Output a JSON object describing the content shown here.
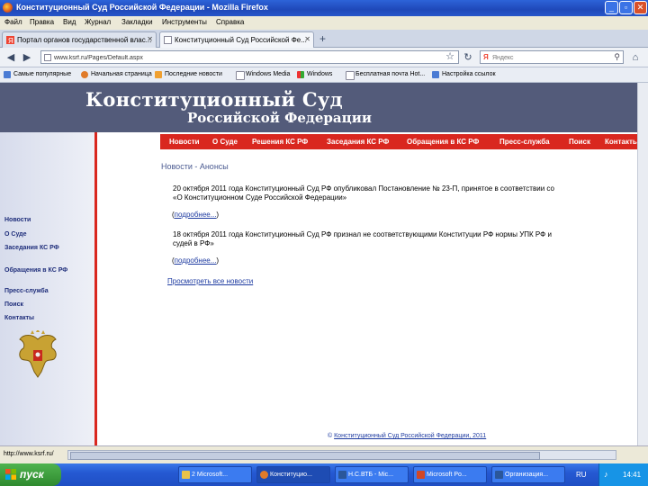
{
  "window": {
    "title": "Конституционный Суд Российской Федерации - Mozilla Firefox",
    "buttons": [
      "_",
      "▫",
      "✕"
    ]
  },
  "menu": [
    "Файл",
    "Правка",
    "Вид",
    "Журнал",
    "Закладки",
    "Инструменты",
    "Справка"
  ],
  "tabs": [
    {
      "label": "Портал органов государственной влас...",
      "active": false
    },
    {
      "label": "Конституционный Суд Российской Фе...",
      "active": true
    }
  ],
  "new_tab_label": "+",
  "nav": {
    "url": "www.ksrf.ru/Pages/Default.aspx",
    "search_placeholder": "Яндекс"
  },
  "bookmarks": [
    "Самые популярные",
    "Начальная страница",
    "Последние новости",
    "Windows Media",
    "Windows",
    "Бесплатная почта Hot...",
    "Настройка ссылок"
  ],
  "site": {
    "title_line1": "Конституционный Суд",
    "title_line2": "Российской Федерации",
    "top_nav": [
      "Новости",
      "О Суде",
      "Решения КС РФ",
      "Заседания КС РФ",
      "Обращения в КС РФ",
      "Пресс-служба",
      "Поиск",
      "Контакты"
    ],
    "sidebar": [
      "Новости",
      "О Суде",
      "Заседания КС РФ",
      "Обращения в КС РФ",
      "Пресс-служба",
      "Поиск",
      "Контакты"
    ],
    "section_title": "Новости - Анонсы",
    "news": [
      {
        "line1": "20 октября 2011 года Конституционный Суд РФ опубликовал Постановление № 23-П, принятое в соответствии со",
        "line2": "«О Конституционном Суде Российской Федерации»",
        "more": "подробнее..."
      },
      {
        "line1": "18 октября 2011 года Конституционный Суд РФ признал не соответствующими Конституции РФ нормы УПК РФ и",
        "line2": "судей в РФ»",
        "more": "подробнее..."
      }
    ],
    "all_news_link": "Просмотреть все новости",
    "footer": "Конституционный Суд Российской Федерации, 2011"
  },
  "status": {
    "text": "http://www.ksrf.ru/"
  },
  "taskbar": {
    "start": "пуск",
    "items": [
      "2 Microsoft...",
      "Конституцио...",
      "Н.С.ВТБ - Mic...",
      "Microsoft Po...",
      "Организация..."
    ],
    "lang": "RU",
    "clock": "14:41"
  },
  "colors": {
    "header_bg": "#535b7a",
    "nav_red": "#d9271f",
    "link_blue": "#1d3aa0"
  }
}
